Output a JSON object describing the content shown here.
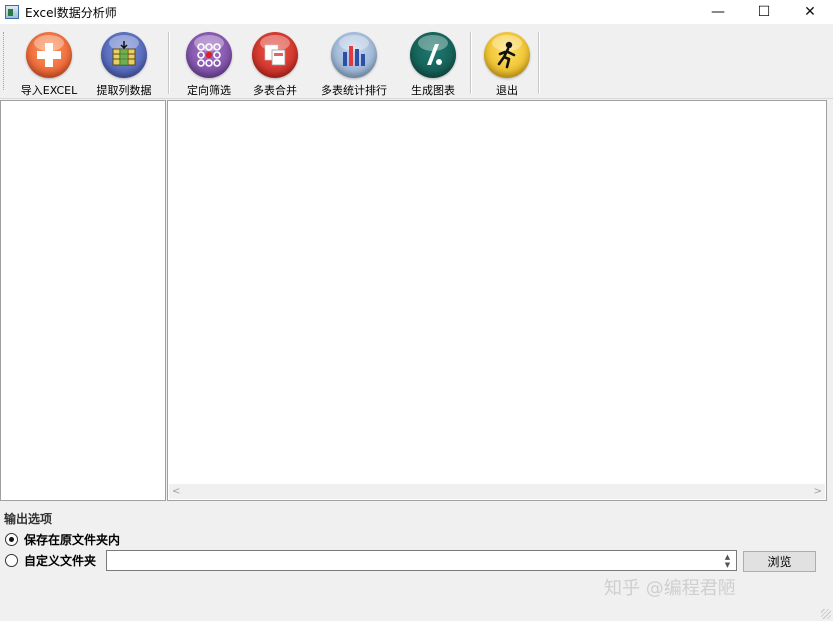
{
  "window": {
    "title": "Excel数据分析师",
    "minimize": "—",
    "maximize": "☐",
    "close": "✕"
  },
  "toolbar": {
    "buttons": [
      {
        "id": "import",
        "label": "导入EXCEL",
        "icon": "plus-icon"
      },
      {
        "id": "extract",
        "label": "提取列数据",
        "icon": "column-extract-icon"
      },
      {
        "id": "filter",
        "label": "定向筛选",
        "icon": "filter-dots-icon"
      },
      {
        "id": "merge",
        "label": "多表合并",
        "icon": "merge-sheets-icon"
      },
      {
        "id": "stats",
        "label": "多表统计排行",
        "icon": "bar-stats-icon"
      },
      {
        "id": "chart",
        "label": "生成图表",
        "icon": "chart-icon"
      },
      {
        "id": "exit",
        "label": "退出",
        "icon": "running-man-icon"
      }
    ]
  },
  "main": {
    "hscroll_left": "<",
    "hscroll_right": ">"
  },
  "output": {
    "title": "输出选项",
    "options": [
      {
        "label": "保存在原文件夹内",
        "checked": true
      },
      {
        "label": "自定义文件夹",
        "checked": false
      }
    ],
    "path_value": "",
    "browse_label": "浏览"
  },
  "watermark": "知乎 @编程君陋"
}
